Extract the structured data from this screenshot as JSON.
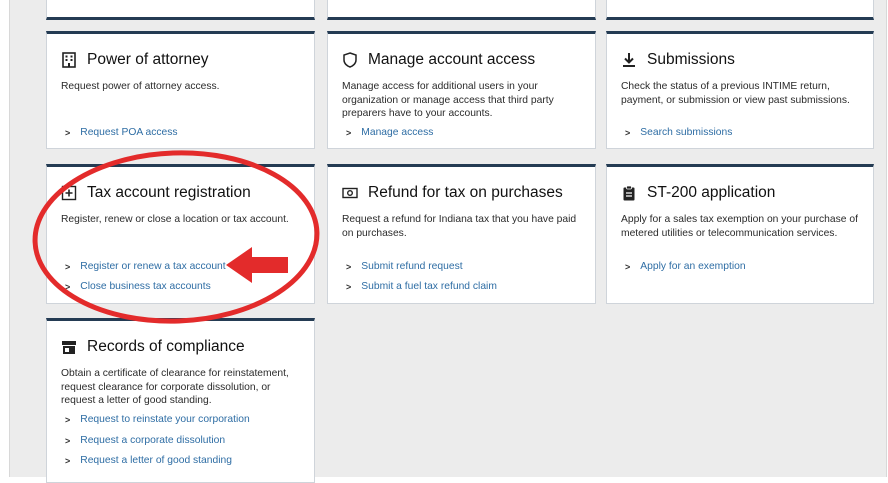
{
  "cards": {
    "poa": {
      "title": "Power of attorney",
      "description": "Request power of attorney access.",
      "links": [
        "Request POA access"
      ]
    },
    "access": {
      "title": "Manage account access",
      "description": "Manage access for additional users in your organization or manage access that third party preparers have to your accounts.",
      "links": [
        "Manage access"
      ]
    },
    "submissions": {
      "title": "Submissions",
      "description": "Check the status of a previous INTIME return, payment, or submission or view past submissions.",
      "links": [
        "Search submissions"
      ]
    },
    "registration": {
      "title": "Tax account registration",
      "description": "Register, renew or close a location or tax account.",
      "links": [
        "Register or renew a tax account",
        "Close business tax accounts"
      ]
    },
    "refund": {
      "title": "Refund for tax on purchases",
      "description": "Request a refund for Indiana tax that you have paid on purchases.",
      "links": [
        "Submit refund request",
        "Submit a fuel tax refund claim"
      ]
    },
    "st200": {
      "title": "ST-200 application",
      "description": "Apply for a sales tax exemption on your purchase of metered utilities or telecommunication services.",
      "links": [
        "Apply for an exemption"
      ]
    },
    "compliance": {
      "title": "Records of compliance",
      "description": "Obtain a certificate of clearance for reinstatement, request clearance for corporate dissolution, or request a letter of good standing.",
      "links": [
        "Request to reinstate your corporation",
        "Request a corporate dissolution",
        "Request a letter of good standing"
      ]
    }
  },
  "annotation": {
    "color": "#e32b2b"
  },
  "colors": {
    "accent": "#243b53",
    "link": "#2e6da4"
  }
}
